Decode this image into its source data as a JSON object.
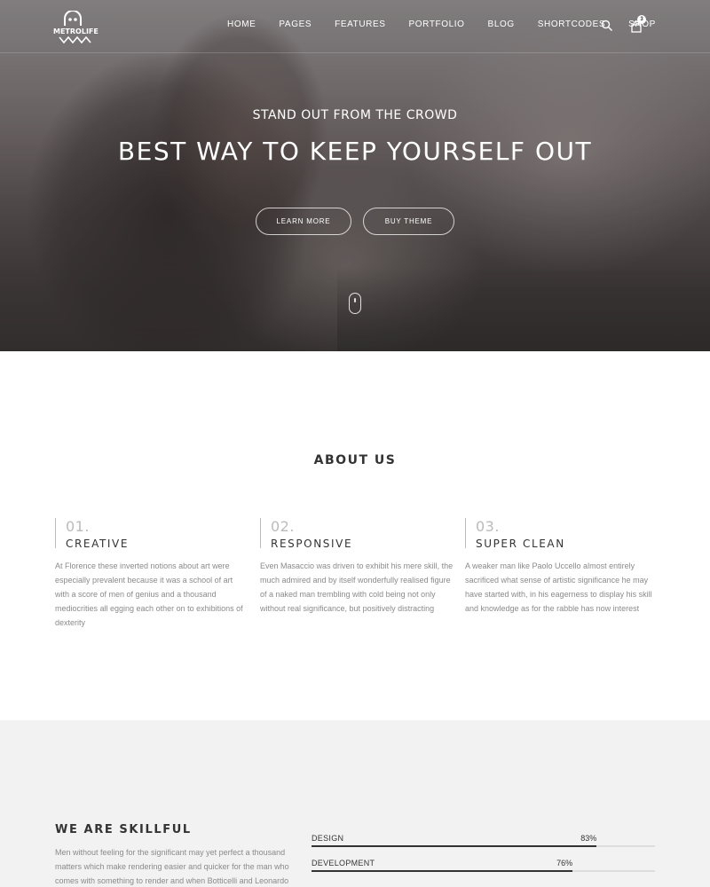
{
  "brand": {
    "name": "METROLIFE"
  },
  "nav": {
    "items": [
      "HOME",
      "PAGES",
      "FEATURES",
      "PORTFOLIO",
      "BLOG",
      "SHORTCODES",
      "SHOP"
    ],
    "cart_count": "3",
    "search_icon": "search-icon",
    "cart_icon": "cart-icon"
  },
  "hero": {
    "subtitle": "STAND OUT FROM THE CROWD",
    "title": "BEST WAY TO KEEP YOURSELF OUT",
    "buttons": {
      "learn_more": "LEARN MORE",
      "buy_theme": "BUY THEME"
    },
    "scroll_icon": "mouse-icon"
  },
  "about": {
    "title": "ABOUT US",
    "features": [
      {
        "number": "01.",
        "title": "CREATIVE",
        "text": "At Florence these inverted notions about art were especially prevalent because it was a school of art with a score of men of genius and a thousand mediocrities all egging each other on to exhibitions of dexterity"
      },
      {
        "number": "02.",
        "title": "RESPONSIVE",
        "text": "Even Masaccio was driven to exhibit his mere skill, the much admired and by itself wonderfully realised figure of a naked man trembling with cold being not only without real significance, but positively distracting"
      },
      {
        "number": "03.",
        "title": "SUPER CLEAN",
        "text": "A weaker man like Paolo Uccello almost entirely sacrificed what sense of artistic significance he may have started with, in his eagerness to display his skill and knowledge as for the rabble has now interest"
      }
    ]
  },
  "skills": {
    "title": "WE ARE SKILLFUL",
    "text": "Men without feeling for the significant may yet perfect a thousand matters which make rendering easier and quicker for the man who comes with something to render and when Botticelli and Leonardo",
    "items": [
      {
        "label": "DESIGN",
        "percent_text": "83%",
        "percent": 83
      },
      {
        "label": "DEVELOPMENT",
        "percent_text": "76%",
        "percent": 76
      }
    ]
  },
  "colors": {
    "hero_text": "#ffffff",
    "heading": "#333333",
    "body_text": "#8a8a8a",
    "muted_number": "#bbbbbb",
    "skills_bg": "#f2f2f2",
    "bar_fill": "#333333",
    "bar_track": "#dddddd"
  }
}
